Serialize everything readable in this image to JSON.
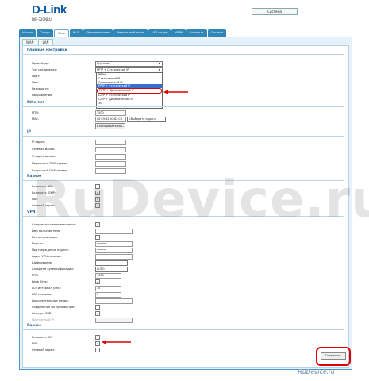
{
  "header": {
    "brand": "D-Link",
    "model": "DIR-320NRU",
    "system_label": "Система"
  },
  "tabs": [
    {
      "label": "Начало"
    },
    {
      "label": "Статус"
    },
    {
      "label": "Сеть"
    },
    {
      "label": "Wi-Fi"
    },
    {
      "label": "Дополнительно"
    },
    {
      "label": "Межсетевой экран"
    },
    {
      "label": "USB-модем"
    },
    {
      "label": "WMM"
    },
    {
      "label": "Контроль"
    },
    {
      "label": "Система"
    }
  ],
  "subtabs": [
    "WAN",
    "LAN"
  ],
  "sections": {
    "main": "Главные настройки",
    "ethernet": "Ethernet",
    "ip": "IP",
    "misc": "Разное",
    "vpn": "VPN",
    "misc2": "Разное"
  },
  "main": {
    "provider_label": "Провайдер:",
    "provider_value": "Вручную",
    "conn_type_label": "Тип соединения:",
    "conn_type_value": "PPTP + Статический IP",
    "port_label": "Порт:",
    "name_label": "Имя:",
    "allow_label": "Разрешить:",
    "direction_label": "Направление:"
  },
  "dropdown": [
    "PPPoE",
    "Статический IP",
    "Динамический IP",
    "PPTP + Статический IP",
    "PPTP + Динамический IP",
    "L2TP + Статический IP",
    "L2TP + Динамический IP",
    "3G"
  ],
  "ethernet": {
    "mtu_label": "MTU:",
    "mtu_value": "1500",
    "mac_label": "MAC:",
    "mac_value": "00:C9:82:47:82:C9",
    "mac_select": "<Выберите адрес>",
    "clone_label": "Клонировать MAC"
  },
  "ip": {
    "ip_label": "IP-адрес:",
    "mask_label": "Сетевая маска:",
    "gw_label": "IP-адрес шлюза:",
    "dns1_label": "Первичный DNS-сервер:",
    "dns2_label": "Вторичный DNS-сервер:"
  },
  "misc": {
    "rip_label": "Включить RIP:",
    "igmp_label": "Включить IGMP:",
    "nat_label": "NAT:",
    "fw_label": "Сетевой экран:"
  },
  "vpn": {
    "auto_label": "Соединяться автоматически:",
    "user_label": "Имя пользователя:",
    "noauth_label": "Без авторизации:",
    "pass_label": "Пароль:",
    "pass_value": "••••••",
    "pass2_label": "Подтверждение пароля:",
    "pass2_value": "••••••",
    "server_label": "Адрес VPN-сервера:",
    "enc_label": "Шифрование:",
    "auth_label": "Алгоритм аутентификации:",
    "auth_value": "AUTO",
    "mtu_label": "MTU:",
    "mtu_value": "1456",
    "keepalive_label": "Keep Alive:",
    "lcp_int_label": "LCP интервал (сек):",
    "lcp_int_value": "30",
    "lcp_fail_label": "LCP провалы:",
    "lcp_fail_value": "3",
    "extra_label": "Дополнительные опции:",
    "ondemand_label": "Соединение по требованию:",
    "debug_label": "Отладка PPP:",
    "static_ip_label": "Постоянный IP:"
  },
  "misc2": {
    "rip_label": "Включить RIP:",
    "nat_label": "NAT:",
    "fw_label": "Сетевой экран:"
  },
  "save_label": "Сохранить",
  "watermark": "RuDevice.ru",
  "watermark_small": "RuDevice.ru",
  "colors": {
    "accent": "#2f86b7",
    "highlight": "#3a6fd2",
    "annotation": "#d00000"
  }
}
